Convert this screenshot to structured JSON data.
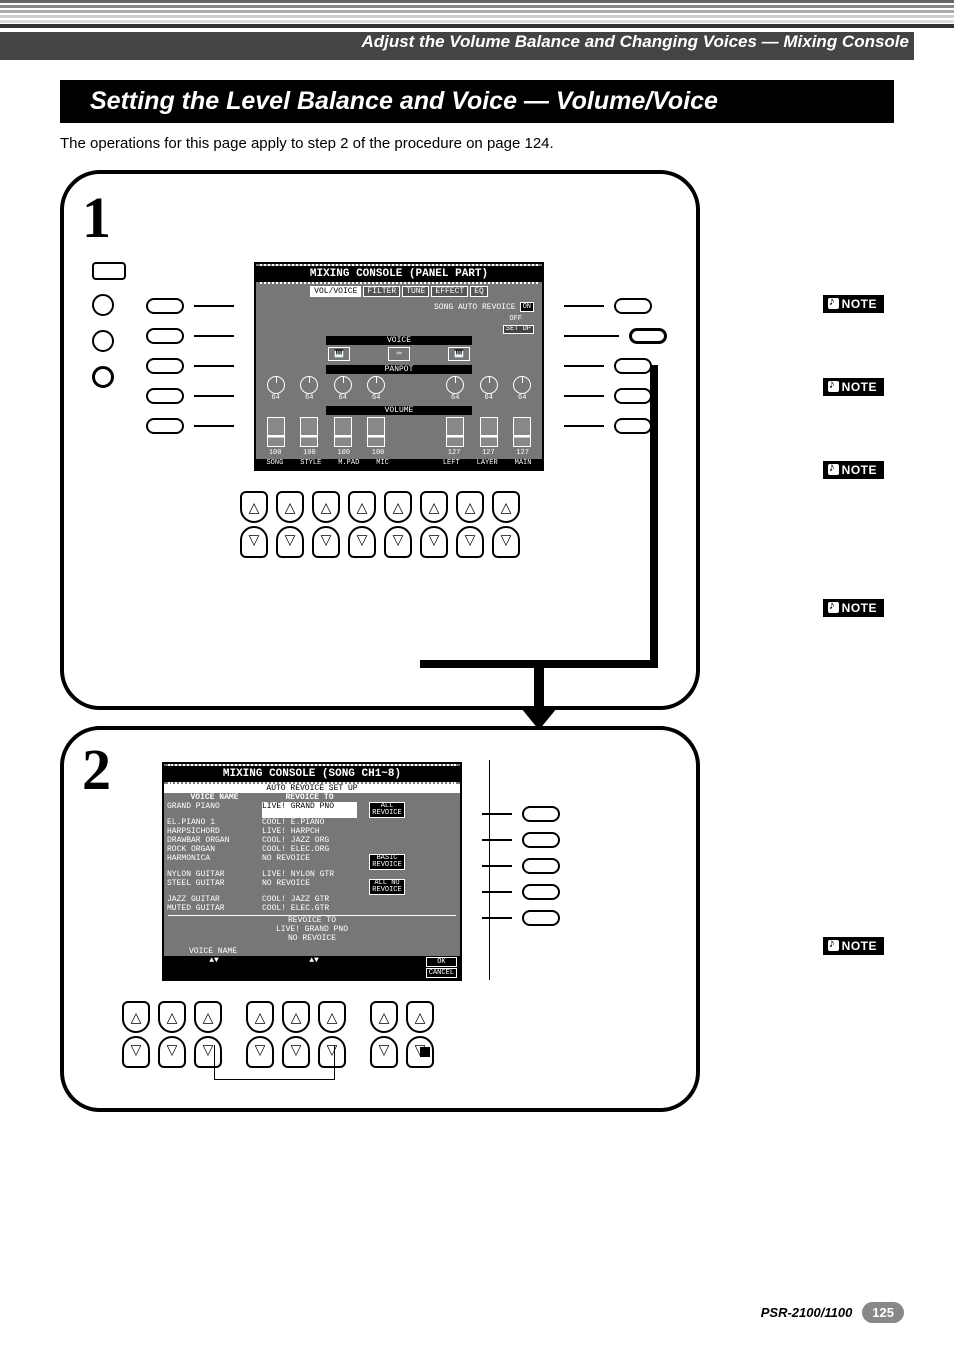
{
  "header": {
    "breadcrumb": "Adjust the Volume Balance and Changing Voices — Mixing Console"
  },
  "section": {
    "heading": "Setting the Level Balance and Voice — Volume/Voice",
    "intro": "The operations for this page apply to step 2 of the procedure on page 124."
  },
  "panel1": {
    "num": "1",
    "lcd": {
      "title": "MIXING CONSOLE (PANEL PART)",
      "tabs": [
        "VOL/VOICE",
        "FILTER",
        "TUNE",
        "EFFECT",
        "EQ"
      ],
      "autorevoice_label": "SONG AUTO REVOICE",
      "autorevoice_on": "ON",
      "autorevoice_off": "OFF",
      "setup": "SET\nUP",
      "voice_label": "VOICE",
      "panpot_label": "PANPOT",
      "volume_label": "VOLUME",
      "knob_val": "64",
      "fader_vals_left": [
        "100",
        "100",
        "100",
        "100"
      ],
      "fader_vals_right": [
        "127",
        "127",
        "127"
      ],
      "channels_left": [
        "SONG",
        "STYLE",
        "M.PAD",
        "MIC"
      ],
      "channels_right": [
        "LEFT",
        "LAYER",
        "MAIN"
      ]
    }
  },
  "panel2": {
    "num": "2",
    "lcd": {
      "title": "MIXING CONSOLE (SONG CH1~8)",
      "subtitle": "AUTO REVOICE SET UP",
      "col_a_hdr": "VOICE NAME",
      "col_b_hdr": "REVOICE TO",
      "rows": [
        {
          "a": "GRAND PIANO",
          "b": "LIVE! GRAND PNO"
        },
        {
          "a": "EL.PIANO 1",
          "b": "COOL! E.PIANO"
        },
        {
          "a": "HARPSICHORD",
          "b": "LIVE! HARPCH"
        },
        {
          "a": "DRAWBAR ORGAN",
          "b": "COOL! JAZZ ORG"
        },
        {
          "a": "ROCK ORGAN",
          "b": "COOL! ELEC.ORG"
        },
        {
          "a": "HARMONICA",
          "b": "NO REVOICE"
        },
        {
          "a": "NYLON GUITAR",
          "b": "LIVE! NYLON GTR"
        },
        {
          "a": "STEEL GUITAR",
          "b": "NO REVOICE"
        },
        {
          "a": "JAZZ GUITAR",
          "b": "COOL! JAZZ GTR"
        },
        {
          "a": "MUTED GUITAR",
          "b": "COOL! ELEC.GTR"
        }
      ],
      "revoice_to_box": "REVOICE TO",
      "revoice_to_opt1": "LIVE! GRAND PNO",
      "revoice_to_opt2": "NO REVOICE",
      "all_revoice": "ALL\nREVOICE",
      "basic_revoice": "BASIC\nREVOICE",
      "all_no_revoice": "ALL NO\nREVOICE",
      "ok": "OK",
      "cancel": "CANCEL",
      "voice_name_nav": "VOICE NAME",
      "nav_arrows": "▲▼"
    }
  },
  "notes": {
    "label": "NOTE"
  },
  "footer": {
    "model": "PSR-2100/1100",
    "page": "125"
  }
}
